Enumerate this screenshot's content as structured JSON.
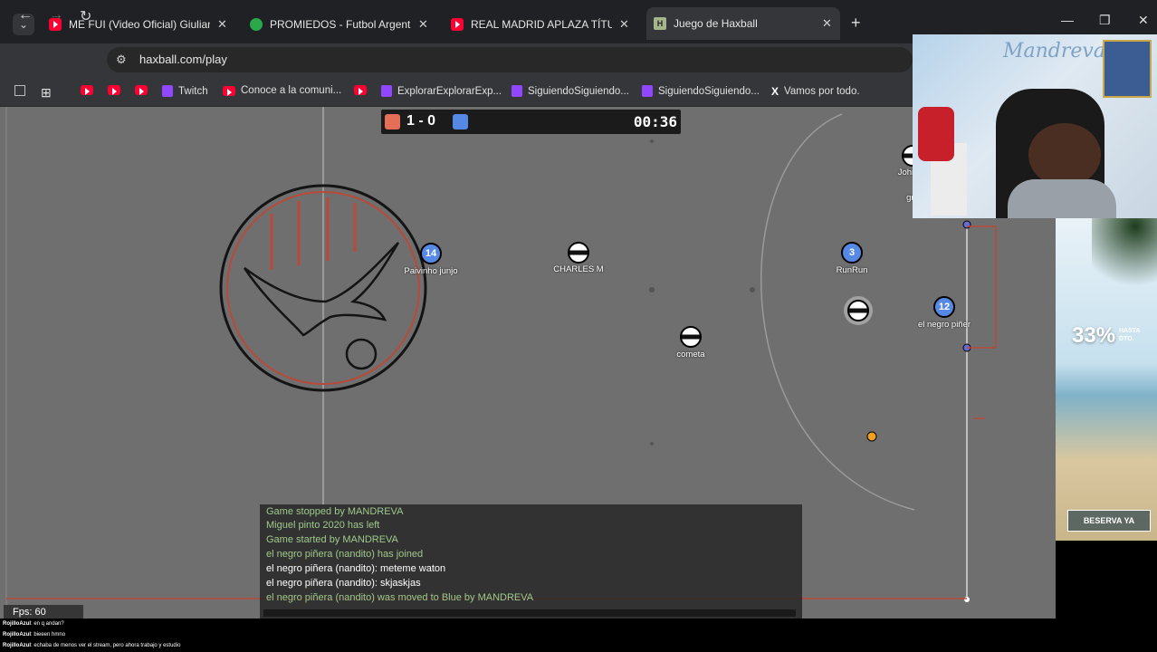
{
  "tabs": [
    {
      "title": "ME FUI (Video Oficial) Giuliano",
      "icon": "youtube-icon"
    },
    {
      "title": "PROMIEDOS - Futbol Argentino",
      "icon": "promiedos-icon"
    },
    {
      "title": "REAL MADRID APLAZA TÍTULO",
      "icon": "youtube-icon"
    },
    {
      "title": "Juego de Haxball",
      "icon": "haxball-icon",
      "active": true
    }
  ],
  "address_bar": {
    "url": "haxball.com/play"
  },
  "bookmarks": [
    {
      "label": "",
      "icon": "youtube-icon"
    },
    {
      "label": "",
      "icon": "youtube-icon"
    },
    {
      "label": "",
      "icon": "youtube-icon"
    },
    {
      "label": "Twitch",
      "icon": "twitch-icon"
    },
    {
      "label": "Conoce a la comuni...",
      "icon": "youtube-icon"
    },
    {
      "label": "",
      "icon": "youtube-icon"
    },
    {
      "label": "ExplorarExplorarExp...",
      "icon": "twitch-icon"
    },
    {
      "label": "SiguiendoSiguiendo...",
      "icon": "twitch-icon"
    },
    {
      "label": "SiguiendoSiguiendo...",
      "icon": "twitch-icon"
    },
    {
      "label": "Vamos por todo.",
      "icon": "x-icon"
    }
  ],
  "scoreboard": {
    "score": "1 - 0",
    "time": "00:36",
    "red_color": "#e56e56",
    "blue_color": "#5689e5"
  },
  "players": [
    {
      "number": "14",
      "name": "Paivinho junjo",
      "team": "blue"
    },
    {
      "number": "",
      "name": "CHARLES M",
      "team": "kit"
    },
    {
      "number": "3",
      "name": "RunRun",
      "team": "blue"
    },
    {
      "number": "12",
      "name": "el negro piñer",
      "team": "blue"
    },
    {
      "number": "",
      "name": "cometa",
      "team": "kit"
    },
    {
      "number": "",
      "name": "",
      "team": "kit"
    },
    {
      "number": "",
      "name": "John",
      "team": "kit"
    },
    {
      "number": "",
      "name": "gre",
      "team": "kit"
    }
  ],
  "fps": "Fps: 60",
  "chat": [
    {
      "text": "Game stopped by MANDREVA",
      "type": "sys"
    },
    {
      "text": "Miguel pinto 2020 has left",
      "type": "sys"
    },
    {
      "text": "Game started by MANDREVA",
      "type": "sys"
    },
    {
      "text": "el negro piñera (nandito) has joined",
      "type": "sys"
    },
    {
      "text": "el negro piñera (nandito): meteme waton",
      "type": "msg"
    },
    {
      "text": "el negro piñera (nandito): skjaskjas",
      "type": "msg"
    },
    {
      "text": "el negro piñera (nandito) was moved to Blue by MANDREVA",
      "type": "sys"
    }
  ],
  "ad": {
    "percent": "33%",
    "subtitle": "HASTA DTO.",
    "button": "BESERVA YA"
  },
  "webcam": {
    "sign": "Mandreva"
  },
  "stream_chat": [
    {
      "user": "RojilloAzul",
      "text": ": en q andan?"
    },
    {
      "user": "RojilloAzul",
      "text": ": bieeen hmno"
    },
    {
      "user": "RojilloAzul",
      "text": ": echaba de menos ver el stream, pero ahora trabajo y estudio"
    }
  ]
}
